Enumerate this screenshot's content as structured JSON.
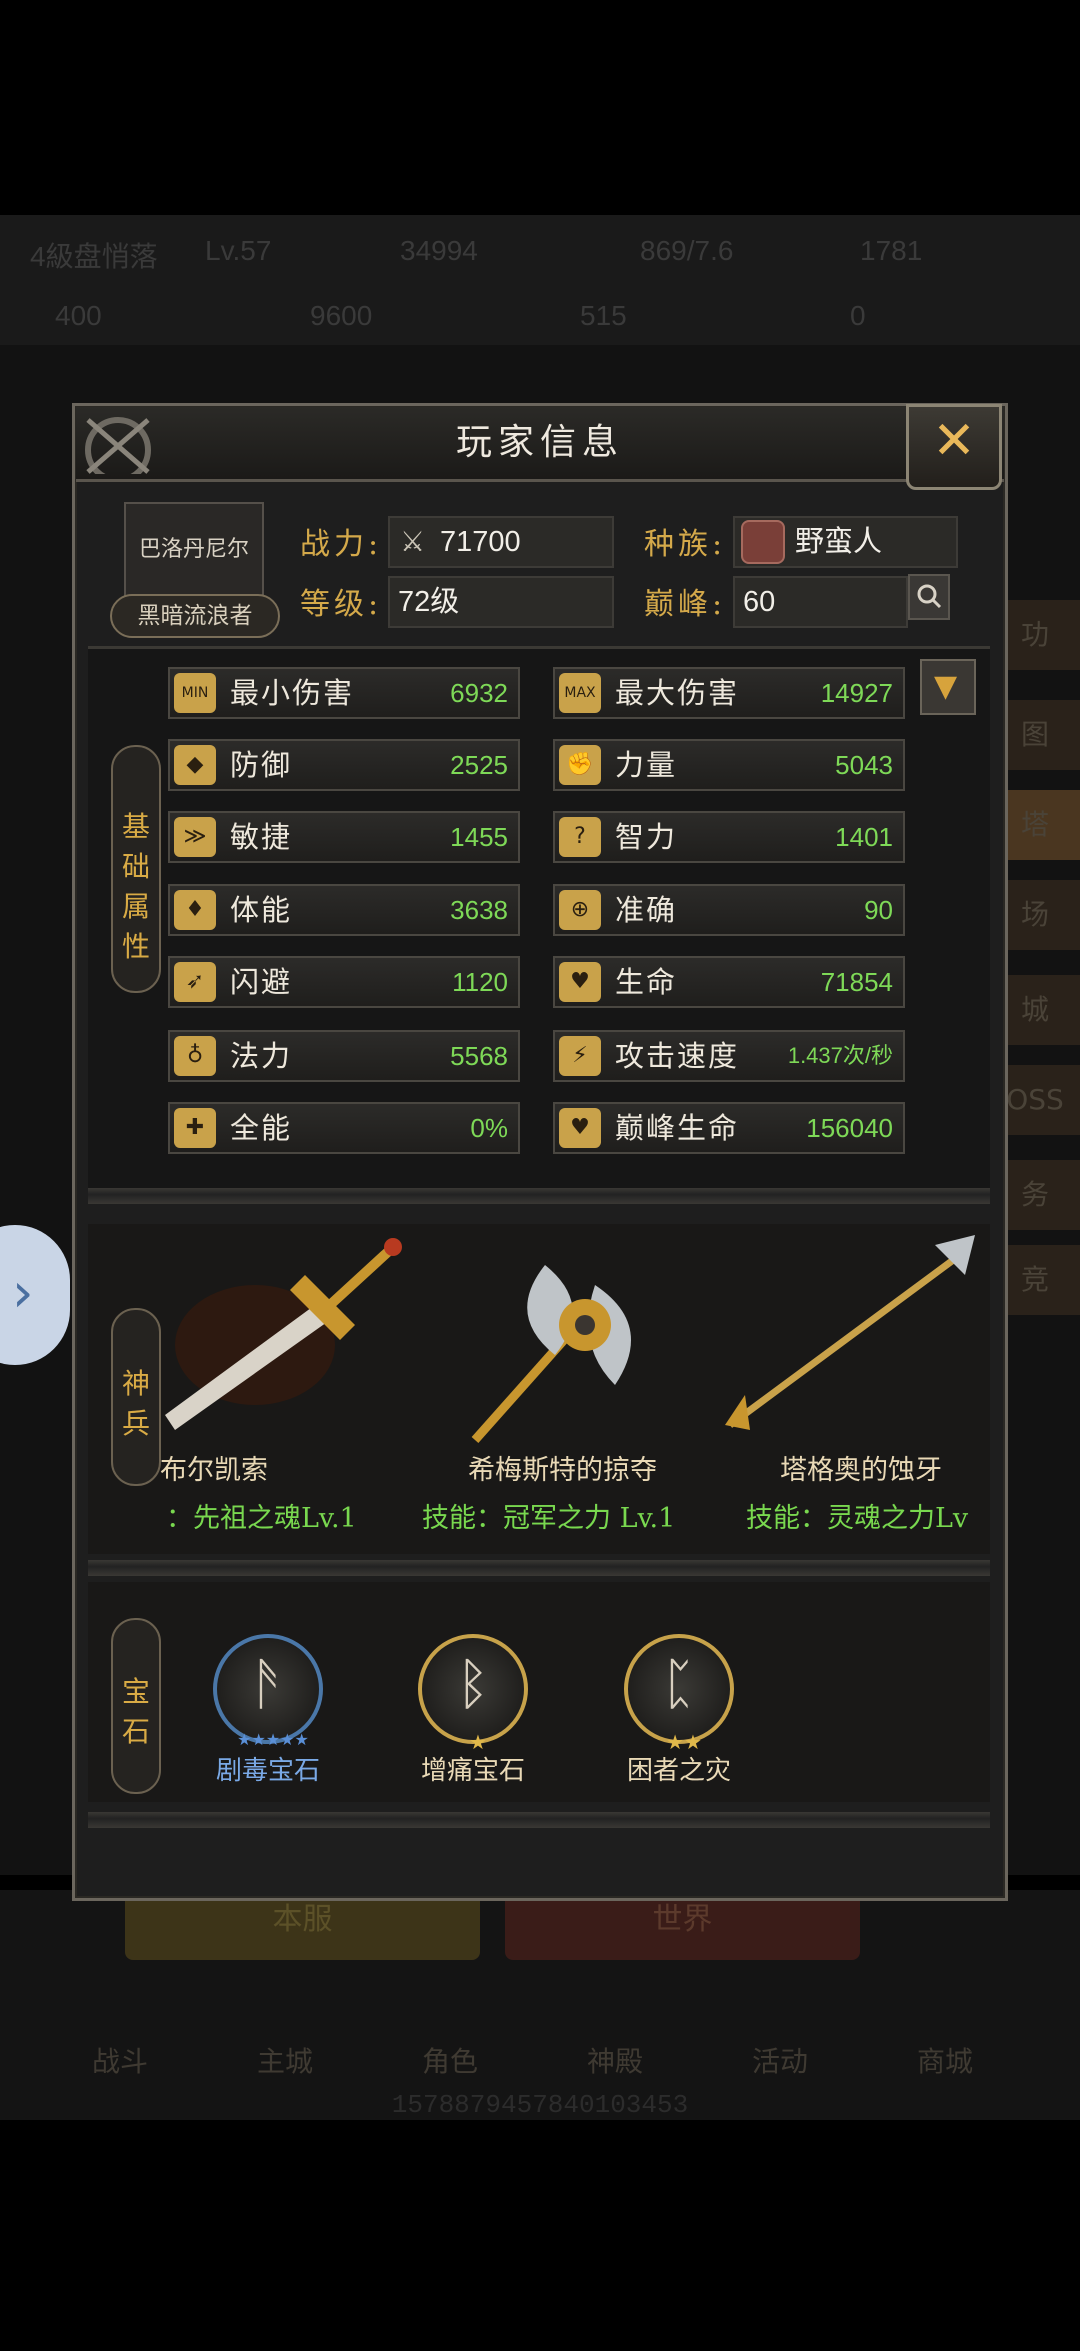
{
  "background": {
    "stats_row1": [
      "4級盘悄落",
      "Lv.57",
      "34994",
      "869/7.6",
      "1781"
    ],
    "stats_row2": [
      "400",
      "9600",
      "515",
      "0"
    ],
    "side_labels": [
      "功",
      "图",
      "塔",
      "场",
      "城",
      "OSS",
      "务",
      "竞"
    ],
    "buttons": {
      "server": "本服",
      "world": "世界"
    },
    "bottom_tabs": [
      "战斗",
      "主城",
      "角色",
      "神殿",
      "活动",
      "商城"
    ],
    "uid": "1578879457840103453",
    "side_arrow": "›"
  },
  "dialog": {
    "title": "玩家信息",
    "close_icon": "✕",
    "player": {
      "name": "巴洛丹尼尔",
      "title_badge": "黑暗流浪者",
      "power_label": "战力:",
      "power": "71700",
      "level_label": "等级:",
      "level": "72级",
      "race_label": "种族:",
      "race": "野蛮人",
      "peak_label": "巅峰:",
      "peak": "60"
    },
    "base_attr_tag": [
      "基",
      "础",
      "属",
      "性"
    ],
    "stats_left": [
      {
        "icon": "MIN",
        "name": "最小伤害",
        "value": "6932"
      },
      {
        "icon": "◆",
        "name": "防御",
        "value": "2525"
      },
      {
        "icon": "≫",
        "name": "敏捷",
        "value": "1455"
      },
      {
        "icon": "♦",
        "name": "体能",
        "value": "3638"
      },
      {
        "icon": "➶",
        "name": "闪避",
        "value": "1120"
      },
      {
        "icon": "♁",
        "name": "法力",
        "value": "5568"
      },
      {
        "icon": "✚",
        "name": "全能",
        "value": "0%"
      }
    ],
    "stats_right": [
      {
        "icon": "MAX",
        "name": "最大伤害",
        "value": "14927"
      },
      {
        "icon": "✊",
        "name": "力量",
        "value": "5043"
      },
      {
        "icon": "?",
        "name": "智力",
        "value": "1401"
      },
      {
        "icon": "⊕",
        "name": "准确",
        "value": "90"
      },
      {
        "icon": "♥",
        "name": "生命",
        "value": "71854"
      },
      {
        "icon": "⚡",
        "name": "攻击速度",
        "value": "1.437次/秒"
      },
      {
        "icon": "♥",
        "name": "巅峰生命",
        "value": "156040"
      }
    ],
    "weapons_tag": [
      "神",
      "兵"
    ],
    "weapons": [
      {
        "name": "布尔凯索",
        "skill": "：先祖之魂Lv.1"
      },
      {
        "name": "希梅斯特的掠夺",
        "skill": "技能：冠军之力 Lv.1"
      },
      {
        "name": "塔格奥的蚀牙",
        "skill": "技能：灵魂之力Lv"
      }
    ],
    "gems_tag": [
      "宝",
      "石"
    ],
    "gems": [
      {
        "name": "剧毒宝石",
        "stars": "★★★★★",
        "ring": "#4a77a8",
        "glyph": "ᚫ"
      },
      {
        "name": "增痛宝石",
        "stars": "★",
        "ring": "#c7a24a",
        "glyph": "ᛒ"
      },
      {
        "name": "困者之灾",
        "stars": "★★",
        "ring": "#c7a24a",
        "glyph": "ᛈ"
      }
    ],
    "colors": {
      "accent": "#d4a94a",
      "value_green": "#7ed957"
    }
  }
}
